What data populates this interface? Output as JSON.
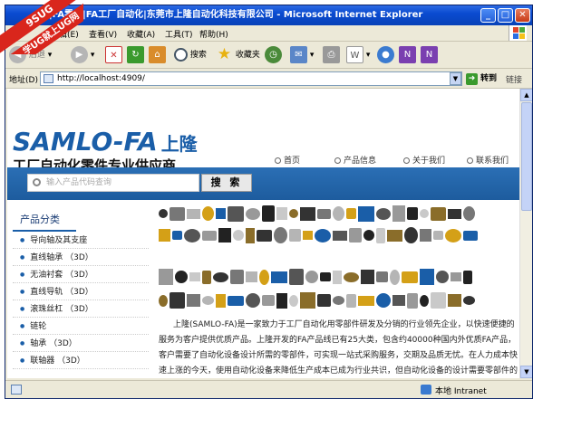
{
  "window": {
    "title": "|FA零件|FA工厂自动化|东莞市上隆自动化科技有限公司 - Microsoft Internet Explorer"
  },
  "watermark": {
    "line1": "9SUG",
    "line2": "学UG就上UG网"
  },
  "menu": [
    "编辑(E)",
    "查看(V)",
    "收藏(A)",
    "工具(T)",
    "帮助(H)"
  ],
  "toolbar": {
    "back": "后退",
    "search": "搜索",
    "favorites": "收藏夹"
  },
  "address": {
    "label": "地址(D)",
    "url": "http://localhost:4909/",
    "go": "转到",
    "links": "链接"
  },
  "site": {
    "logo_en": "SAMLO-FA",
    "logo_cn": "上隆",
    "tagline": "工厂自动化零件专业供应商",
    "nav": [
      "首页",
      "产品信息",
      "关于我们",
      "联系我们"
    ],
    "search_placeholder": "输入产品代码查询",
    "search_button": "搜 索",
    "sidebar_title": "产品分类",
    "categories": [
      "导向轴及其支座",
      "直线轴承 （3D）",
      "无油衬套 （3D）",
      "直线导轨 （3D）",
      "滚珠丝杠 （3D）",
      "链轮",
      "轴承 （3D）",
      "联轴器 （3D）"
    ],
    "intro": "上隆(SAMLO-FA)是一家致力于工厂自动化用零部件研发及分销的行业领先企业，以快速便捷的服务为客户提供优质产品。上隆开发的FA产品线已有25大类，包含约40000种国内外优质FA产品，客户需要了自动化设备设计所需的零部件，可实现一站式采购服务，交期及品质无忧。在人力成本快速上涨的今天，使用自动化设备来降低生产成本已成为行业共识，但自动化设备的设计需要零部件的支持。能提高人类生活的幸福感，使人从单调枯燥的重复劳动中解放出来。上隆的使命是通过提供优质的产品和服务。"
  },
  "status": {
    "zone": "本地 Intranet"
  },
  "colors": {
    "brand": "#1a5ea8",
    "titlebar": "#0a4bd0",
    "search_bar": "#1d5c9e"
  }
}
